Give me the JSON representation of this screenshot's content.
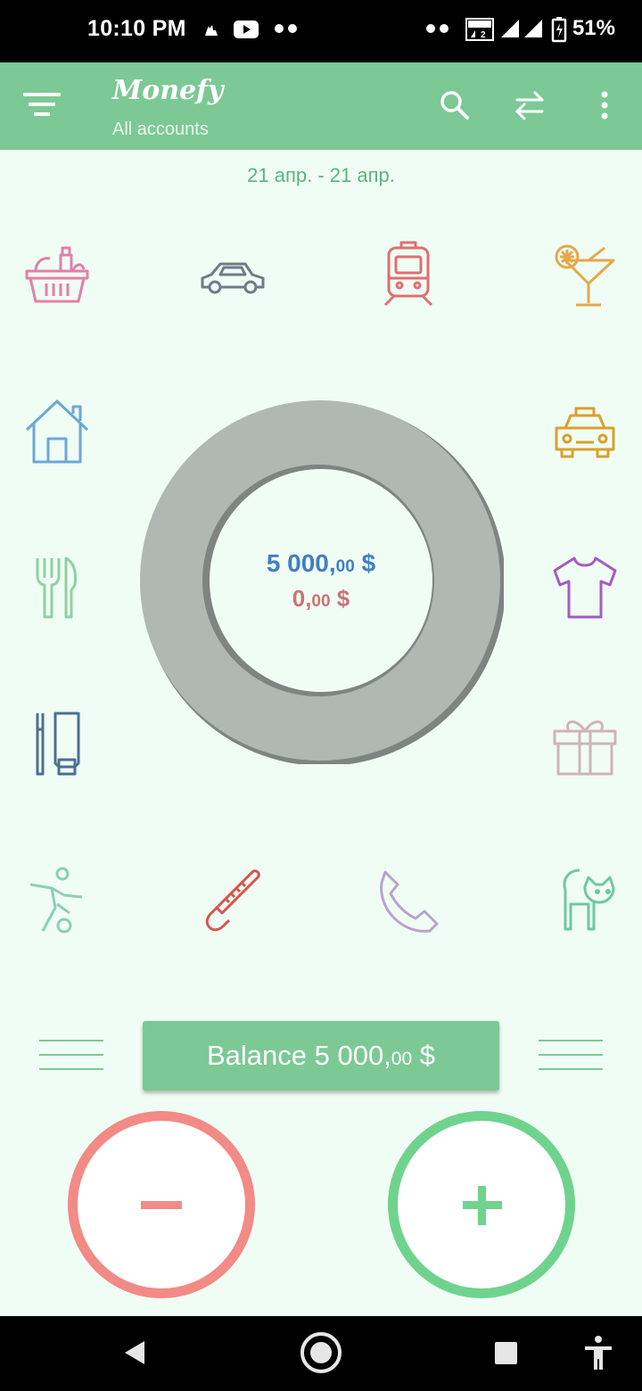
{
  "status_bar": {
    "time": "10:10 PM",
    "battery_percent": "51%",
    "icons": [
      "notification-icon",
      "youtube-icon",
      "more-dots-icon",
      "more-dots-icon",
      "volte-icon",
      "signal-icon",
      "signal-icon",
      "battery-charging-icon"
    ]
  },
  "toolbar": {
    "title": "Monefy",
    "subtitle": "All accounts",
    "icons": [
      "menu-filter-icon",
      "search-icon",
      "transfer-icon",
      "more-vert-icon"
    ]
  },
  "period": "21 апр. - 21 апр.",
  "categories": [
    {
      "name": "groceries",
      "icon": "basket-icon",
      "color": "#E27FA8"
    },
    {
      "name": "car",
      "icon": "car-icon",
      "color": "#6F7B88"
    },
    {
      "name": "transport",
      "icon": "train-icon",
      "color": "#E06F6F"
    },
    {
      "name": "entertainment",
      "icon": "cocktail-icon",
      "color": "#E5A84B"
    },
    {
      "name": "house",
      "icon": "house-icon",
      "color": "#6BA8D6"
    },
    {
      "name": "taxi",
      "icon": "taxi-icon",
      "color": "#D9A12B"
    },
    {
      "name": "eating-out",
      "icon": "fork-knife-icon",
      "color": "#8FD0A3"
    },
    {
      "name": "clothes",
      "icon": "tshirt-icon",
      "color": "#A55BC4"
    },
    {
      "name": "toiletry",
      "icon": "toiletry-icon",
      "color": "#4B6F93"
    },
    {
      "name": "gifts",
      "icon": "gift-icon",
      "color": "#D0B3B9"
    },
    {
      "name": "sports",
      "icon": "soccer-icon",
      "color": "#8CCFB3"
    },
    {
      "name": "health",
      "icon": "thermometer-icon",
      "color": "#D8544D"
    },
    {
      "name": "communications",
      "icon": "phone-icon",
      "color": "#B8A3CE"
    },
    {
      "name": "pets",
      "icon": "cat-icon",
      "color": "#6CC9A0"
    }
  ],
  "donut": {
    "fill_color": "#AFB8B2",
    "income_main": "5 000,",
    "income_cents": "00",
    "income_currency": " $",
    "expense_main": "0,",
    "expense_cents": "00",
    "expense_currency": " $"
  },
  "balance": {
    "label_main": "Balance 5 000,",
    "label_cents": "00",
    "label_currency": " $"
  },
  "actions": {
    "expense_color": "#F28A86",
    "income_color": "#6FD38E"
  },
  "nav": [
    "back-icon",
    "home-icon",
    "recents-icon",
    "accessibility-icon"
  ]
}
